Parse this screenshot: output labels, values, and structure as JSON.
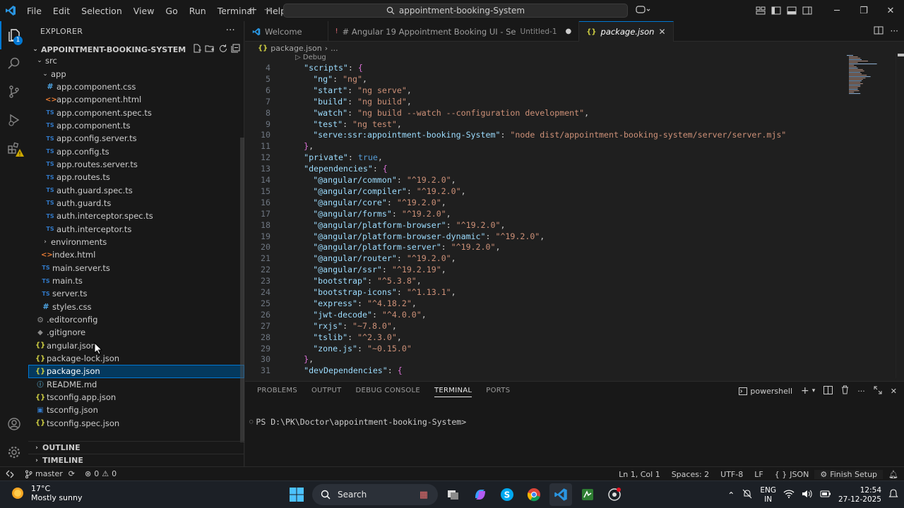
{
  "menu": [
    "File",
    "Edit",
    "Selection",
    "View",
    "Go",
    "Run",
    "Terminal",
    "Help"
  ],
  "search": {
    "text": "appointment-booking-System"
  },
  "activity": {
    "explorer_badge": "1"
  },
  "sidebar": {
    "header": "EXPLORER",
    "project": "APPOINTMENT-BOOKING-SYSTEM",
    "tree": [
      {
        "indent": 1,
        "kind": "folder-open",
        "label": "src"
      },
      {
        "indent": 2,
        "kind": "folder-open",
        "label": "app"
      },
      {
        "indent": 3,
        "kind": "css",
        "icon": "#",
        "label": "app.component.css"
      },
      {
        "indent": 3,
        "kind": "html",
        "icon": "<>",
        "label": "app.component.html"
      },
      {
        "indent": 3,
        "kind": "ts",
        "icon": "TS",
        "label": "app.component.spec.ts"
      },
      {
        "indent": 3,
        "kind": "ts",
        "icon": "TS",
        "label": "app.component.ts"
      },
      {
        "indent": 3,
        "kind": "ts",
        "icon": "TS",
        "label": "app.config.server.ts"
      },
      {
        "indent": 3,
        "kind": "ts",
        "icon": "TS",
        "label": "app.config.ts"
      },
      {
        "indent": 3,
        "kind": "ts",
        "icon": "TS",
        "label": "app.routes.server.ts"
      },
      {
        "indent": 3,
        "kind": "ts",
        "icon": "TS",
        "label": "app.routes.ts"
      },
      {
        "indent": 3,
        "kind": "ts",
        "icon": "TS",
        "label": "auth.guard.spec.ts"
      },
      {
        "indent": 3,
        "kind": "ts",
        "icon": "TS",
        "label": "auth.guard.ts"
      },
      {
        "indent": 3,
        "kind": "ts",
        "icon": "TS",
        "label": "auth.interceptor.spec.ts"
      },
      {
        "indent": 3,
        "kind": "ts",
        "icon": "TS",
        "label": "auth.interceptor.ts"
      },
      {
        "indent": 2,
        "kind": "folder-closed",
        "label": "environments"
      },
      {
        "indent": 2,
        "kind": "html",
        "icon": "<>",
        "label": "index.html"
      },
      {
        "indent": 2,
        "kind": "ts",
        "icon": "TS",
        "label": "main.server.ts"
      },
      {
        "indent": 2,
        "kind": "ts",
        "icon": "TS",
        "label": "main.ts"
      },
      {
        "indent": 2,
        "kind": "ts",
        "icon": "TS",
        "label": "server.ts"
      },
      {
        "indent": 2,
        "kind": "css",
        "icon": "#",
        "label": "styles.css"
      },
      {
        "indent": 1,
        "kind": "cfg",
        "icon": "⚙",
        "label": ".editorconfig"
      },
      {
        "indent": 1,
        "kind": "git",
        "icon": "◆",
        "label": ".gitignore"
      },
      {
        "indent": 1,
        "kind": "json",
        "icon": "{}",
        "label": "angular.json"
      },
      {
        "indent": 1,
        "kind": "json",
        "icon": "{}",
        "label": "package-lock.json"
      },
      {
        "indent": 1,
        "kind": "json",
        "icon": "{}",
        "label": "package.json",
        "selected": true
      },
      {
        "indent": 1,
        "kind": "md",
        "icon": "ⓘ",
        "label": "README.md"
      },
      {
        "indent": 1,
        "kind": "json",
        "icon": "{}",
        "label": "tsconfig.app.json"
      },
      {
        "indent": 1,
        "kind": "tsc",
        "icon": "▣",
        "label": "tsconfig.json"
      },
      {
        "indent": 1,
        "kind": "json",
        "icon": "{}",
        "label": "tsconfig.spec.json"
      }
    ],
    "outline": "OUTLINE",
    "timeline": "TIMELINE"
  },
  "tabs": [
    {
      "label": "Welcome",
      "desc": "",
      "active": false
    },
    {
      "label": "# Angular 19 Appointment Booking UI - Se",
      "desc": "Untitled-1",
      "active": false,
      "dirty": true
    },
    {
      "label": "package.json",
      "desc": "",
      "active": true
    }
  ],
  "breadcrumb": {
    "file": "package.json",
    "rest": "..."
  },
  "codelens": "▷ Debug",
  "code": [
    {
      "n": "4",
      "indent": 2,
      "parts": [
        [
          "k",
          "\"scripts\""
        ],
        [
          "p",
          ": "
        ],
        [
          "b2",
          "{"
        ]
      ]
    },
    {
      "n": "5",
      "indent": 4,
      "parts": [
        [
          "k",
          "\"ng\""
        ],
        [
          "p",
          ": "
        ],
        [
          "s",
          "\"ng\""
        ],
        [
          "p",
          ","
        ]
      ]
    },
    {
      "n": "6",
      "indent": 4,
      "parts": [
        [
          "k",
          "\"start\""
        ],
        [
          "p",
          ": "
        ],
        [
          "s",
          "\"ng serve\""
        ],
        [
          "p",
          ","
        ]
      ]
    },
    {
      "n": "7",
      "indent": 4,
      "parts": [
        [
          "k",
          "\"build\""
        ],
        [
          "p",
          ": "
        ],
        [
          "s",
          "\"ng build\""
        ],
        [
          "p",
          ","
        ]
      ]
    },
    {
      "n": "8",
      "indent": 4,
      "parts": [
        [
          "k",
          "\"watch\""
        ],
        [
          "p",
          ": "
        ],
        [
          "s",
          "\"ng build --watch --configuration development\""
        ],
        [
          "p",
          ","
        ]
      ]
    },
    {
      "n": "9",
      "indent": 4,
      "parts": [
        [
          "k",
          "\"test\""
        ],
        [
          "p",
          ": "
        ],
        [
          "s",
          "\"ng test\""
        ],
        [
          "p",
          ","
        ]
      ]
    },
    {
      "n": "10",
      "indent": 4,
      "parts": [
        [
          "k",
          "\"serve:ssr:appointment-booking-System\""
        ],
        [
          "p",
          ": "
        ],
        [
          "s",
          "\"node dist/appointment-booking-system/server/server.mjs\""
        ]
      ]
    },
    {
      "n": "11",
      "indent": 2,
      "parts": [
        [
          "b2",
          "}"
        ],
        [
          "p",
          ","
        ]
      ]
    },
    {
      "n": "12",
      "indent": 2,
      "parts": [
        [
          "k",
          "\"private\""
        ],
        [
          "p",
          ": "
        ],
        [
          "kw",
          "true"
        ],
        [
          "p",
          ","
        ]
      ]
    },
    {
      "n": "13",
      "indent": 2,
      "parts": [
        [
          "k",
          "\"dependencies\""
        ],
        [
          "p",
          ": "
        ],
        [
          "b2",
          "{"
        ]
      ]
    },
    {
      "n": "14",
      "indent": 4,
      "parts": [
        [
          "k",
          "\"@angular/common\""
        ],
        [
          "p",
          ": "
        ],
        [
          "s",
          "\"^19.2.0\""
        ],
        [
          "p",
          ","
        ]
      ]
    },
    {
      "n": "15",
      "indent": 4,
      "parts": [
        [
          "k",
          "\"@angular/compiler\""
        ],
        [
          "p",
          ": "
        ],
        [
          "s",
          "\"^19.2.0\""
        ],
        [
          "p",
          ","
        ]
      ]
    },
    {
      "n": "16",
      "indent": 4,
      "parts": [
        [
          "k",
          "\"@angular/core\""
        ],
        [
          "p",
          ": "
        ],
        [
          "s",
          "\"^19.2.0\""
        ],
        [
          "p",
          ","
        ]
      ]
    },
    {
      "n": "17",
      "indent": 4,
      "parts": [
        [
          "k",
          "\"@angular/forms\""
        ],
        [
          "p",
          ": "
        ],
        [
          "s",
          "\"^19.2.0\""
        ],
        [
          "p",
          ","
        ]
      ]
    },
    {
      "n": "18",
      "indent": 4,
      "parts": [
        [
          "k",
          "\"@angular/platform-browser\""
        ],
        [
          "p",
          ": "
        ],
        [
          "s",
          "\"^19.2.0\""
        ],
        [
          "p",
          ","
        ]
      ]
    },
    {
      "n": "19",
      "indent": 4,
      "parts": [
        [
          "k",
          "\"@angular/platform-browser-dynamic\""
        ],
        [
          "p",
          ": "
        ],
        [
          "s",
          "\"^19.2.0\""
        ],
        [
          "p",
          ","
        ]
      ]
    },
    {
      "n": "20",
      "indent": 4,
      "parts": [
        [
          "k",
          "\"@angular/platform-server\""
        ],
        [
          "p",
          ": "
        ],
        [
          "s",
          "\"^19.2.0\""
        ],
        [
          "p",
          ","
        ]
      ]
    },
    {
      "n": "21",
      "indent": 4,
      "parts": [
        [
          "k",
          "\"@angular/router\""
        ],
        [
          "p",
          ": "
        ],
        [
          "s",
          "\"^19.2.0\""
        ],
        [
          "p",
          ","
        ]
      ]
    },
    {
      "n": "22",
      "indent": 4,
      "parts": [
        [
          "k",
          "\"@angular/ssr\""
        ],
        [
          "p",
          ": "
        ],
        [
          "s",
          "\"^19.2.19\""
        ],
        [
          "p",
          ","
        ]
      ]
    },
    {
      "n": "23",
      "indent": 4,
      "parts": [
        [
          "k",
          "\"bootstrap\""
        ],
        [
          "p",
          ": "
        ],
        [
          "s",
          "\"^5.3.8\""
        ],
        [
          "p",
          ","
        ]
      ]
    },
    {
      "n": "24",
      "indent": 4,
      "parts": [
        [
          "k",
          "\"bootstrap-icons\""
        ],
        [
          "p",
          ": "
        ],
        [
          "s",
          "\"^1.13.1\""
        ],
        [
          "p",
          ","
        ]
      ]
    },
    {
      "n": "25",
      "indent": 4,
      "parts": [
        [
          "k",
          "\"express\""
        ],
        [
          "p",
          ": "
        ],
        [
          "s",
          "\"^4.18.2\""
        ],
        [
          "p",
          ","
        ]
      ]
    },
    {
      "n": "26",
      "indent": 4,
      "parts": [
        [
          "k",
          "\"jwt-decode\""
        ],
        [
          "p",
          ": "
        ],
        [
          "s",
          "\"^4.0.0\""
        ],
        [
          "p",
          ","
        ]
      ]
    },
    {
      "n": "27",
      "indent": 4,
      "parts": [
        [
          "k",
          "\"rxjs\""
        ],
        [
          "p",
          ": "
        ],
        [
          "s",
          "\"~7.8.0\""
        ],
        [
          "p",
          ","
        ]
      ]
    },
    {
      "n": "28",
      "indent": 4,
      "parts": [
        [
          "k",
          "\"tslib\""
        ],
        [
          "p",
          ": "
        ],
        [
          "s",
          "\"^2.3.0\""
        ],
        [
          "p",
          ","
        ]
      ]
    },
    {
      "n": "29",
      "indent": 4,
      "parts": [
        [
          "k",
          "\"zone.js\""
        ],
        [
          "p",
          ": "
        ],
        [
          "s",
          "\"~0.15.0\""
        ]
      ]
    },
    {
      "n": "30",
      "indent": 2,
      "parts": [
        [
          "b2",
          "}"
        ],
        [
          "p",
          ","
        ]
      ]
    },
    {
      "n": "31",
      "indent": 2,
      "parts": [
        [
          "k",
          "\"devDependencies\""
        ],
        [
          "p",
          ": "
        ],
        [
          "b2",
          "{"
        ]
      ]
    }
  ],
  "panel": {
    "tabs": [
      "PROBLEMS",
      "OUTPUT",
      "DEBUG CONSOLE",
      "TERMINAL",
      "PORTS"
    ],
    "active_tab": "TERMINAL",
    "shell": "powershell",
    "prompt": "PS D:\\PK\\Doctor\\appointment-booking-System>"
  },
  "status": {
    "branch": "master",
    "errors": "0",
    "warnings": "0",
    "position": "Ln 1, Col 1",
    "spaces": "Spaces: 2",
    "encoding": "UTF-8",
    "eol": "LF",
    "language": "JSON",
    "finish_setup": "Finish Setup"
  },
  "taskbar": {
    "temp": "17°C",
    "weather": "Mostly sunny",
    "search": "Search",
    "lang1": "ENG",
    "lang2": "IN",
    "time": "12:54",
    "date": "27-12-2025"
  },
  "colors": {
    "accent": "#0078d4",
    "selection": "#04395e",
    "string": "#ce9178",
    "key": "#9cdcfe"
  }
}
